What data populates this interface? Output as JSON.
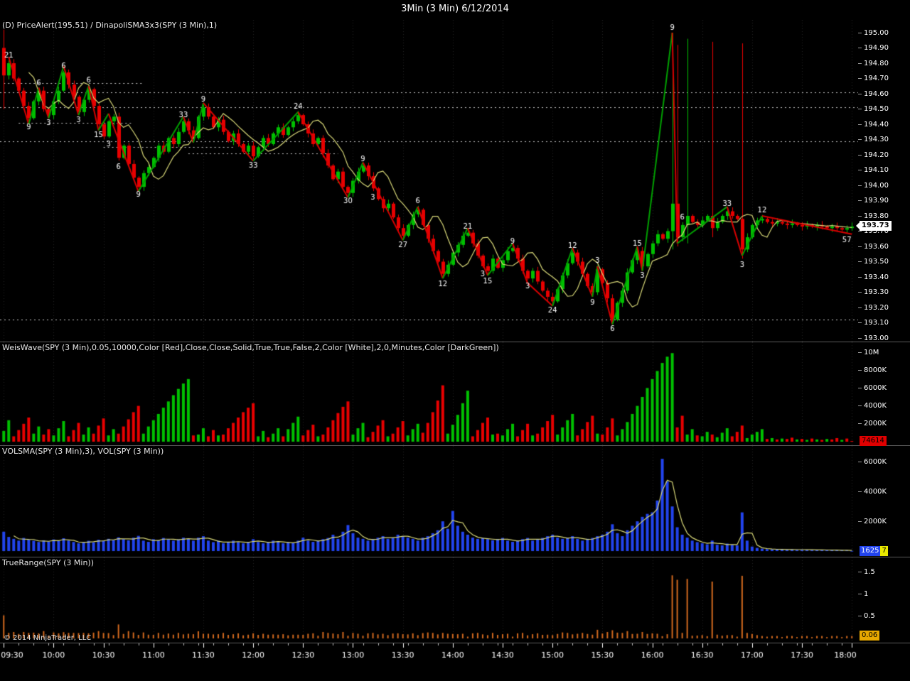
{
  "header": {
    "title": "3Min (3 Min)  6/12/2014"
  },
  "footer": {
    "copyright": "© 2014 NinjaTrader, LLC"
  },
  "colors": {
    "background": "#000000",
    "up": "#00C000",
    "down": "#E80000",
    "sma": "#D8D878",
    "vol": "#2244EE",
    "tr": "#D2691E",
    "grid": "#242424",
    "level": "#C8C8C8",
    "zig_up": "#00A000",
    "zig_down": "#D80000",
    "marker_price_bg": "#FFFFFF",
    "marker_wave_bg": "#E00000",
    "marker_vol_bg": "#2244EE",
    "marker_vol_highlight": "#E8E800",
    "marker_tr_bg": "#E8A800"
  },
  "chart_data": {
    "type": "candlestick",
    "symbol_interval": "SPY (3 Min)",
    "bars_per_label": 10,
    "time_labels": [
      "09:30",
      "10:00",
      "10:30",
      "11:00",
      "11:30",
      "12:00",
      "12:30",
      "13:00",
      "13:30",
      "14:00",
      "14:30",
      "15:00",
      "15:30",
      "16:00",
      "16:30",
      "17:00",
      "17:30",
      "18:00"
    ],
    "panels": [
      {
        "name": "price",
        "label": "(D) PriceAlert(195.51) / DinapoliSMA3x3(SPY (3 Min),1)",
        "ylim": [
          193.0,
          195.0
        ],
        "y_ticks": [
          "195.00",
          "194.90",
          "194.80",
          "194.70",
          "194.60",
          "194.50",
          "194.40",
          "194.30",
          "194.20",
          "194.10",
          "194.00",
          "193.90",
          "193.80",
          "193.70",
          "193.60",
          "193.50",
          "193.40",
          "193.30",
          "193.20",
          "193.10",
          "193.00"
        ],
        "last_value": "193.73",
        "open_first": 194.9,
        "closes": [
          194.72,
          194.8,
          194.7,
          194.62,
          194.52,
          194.44,
          194.55,
          194.62,
          194.5,
          194.46,
          194.55,
          194.62,
          194.74,
          194.66,
          194.58,
          194.48,
          194.56,
          194.63,
          194.52,
          194.4,
          194.32,
          194.42,
          194.45,
          194.18,
          194.26,
          194.14,
          194.05,
          193.99,
          194.08,
          194.12,
          194.18,
          194.26,
          194.22,
          194.31,
          194.27,
          194.35,
          194.42,
          194.36,
          194.31,
          194.45,
          194.51,
          194.45,
          194.38,
          194.43,
          194.35,
          194.29,
          194.34,
          194.27,
          194.22,
          194.26,
          194.19,
          194.25,
          194.31,
          194.27,
          194.34,
          194.38,
          194.33,
          194.38,
          194.42,
          194.46,
          194.4,
          194.34,
          194.27,
          194.31,
          194.21,
          194.13,
          194.04,
          194.09,
          193.99,
          193.95,
          194.03,
          194.09,
          194.13,
          194.06,
          193.98,
          193.91,
          193.85,
          193.88,
          193.79,
          193.72,
          193.67,
          193.74,
          193.81,
          193.84,
          193.74,
          193.65,
          193.57,
          193.5,
          193.42,
          193.48,
          193.56,
          193.61,
          193.67,
          193.69,
          193.62,
          193.54,
          193.47,
          193.44,
          193.52,
          193.46,
          193.51,
          193.57,
          193.59,
          193.52,
          193.44,
          193.39,
          193.44,
          193.37,
          193.31,
          193.27,
          193.24,
          193.32,
          193.41,
          193.49,
          193.56,
          193.5,
          193.42,
          193.34,
          193.3,
          193.45,
          193.36,
          193.26,
          193.12,
          193.23,
          193.31,
          193.43,
          193.51,
          193.57,
          193.47,
          193.55,
          193.62,
          193.68,
          193.65,
          193.7,
          193.88,
          193.66,
          193.74,
          193.8,
          193.76,
          193.74,
          193.77,
          193.8,
          193.72,
          193.76,
          193.8,
          193.83,
          193.8,
          193.78,
          193.58,
          193.66,
          193.74,
          193.77,
          193.78,
          193.76,
          193.75,
          193.76,
          193.75,
          193.74,
          193.75,
          193.74,
          193.73,
          193.74,
          193.73,
          193.74,
          193.73,
          193.72,
          193.73,
          193.72,
          193.71,
          193.72,
          193.73
        ],
        "spikes": {
          "0": {
            "h": 195.02,
            "l": 194.5
          },
          "134": {
            "h": 195.0,
            "l": 193.58
          },
          "135": {
            "h": 194.92,
            "l": 193.6
          },
          "137": {
            "h": 194.96,
            "l": 193.62
          },
          "142": {
            "h": 194.94,
            "l": 193.66
          },
          "148": {
            "h": 194.93,
            "l": 193.52
          }
        },
        "swing_labels": [
          [
            1,
            "21",
            "a"
          ],
          [
            5,
            "9",
            "b"
          ],
          [
            7,
            "6",
            "a"
          ],
          [
            9,
            "3",
            "b"
          ],
          [
            12,
            "6",
            "a"
          ],
          [
            15,
            "3",
            "b"
          ],
          [
            17,
            "6",
            "a"
          ],
          [
            19,
            "15",
            "b"
          ],
          [
            21,
            "3",
            "b"
          ],
          [
            23,
            "6",
            "b"
          ],
          [
            27,
            "9",
            "b"
          ],
          [
            36,
            "33",
            "a"
          ],
          [
            40,
            "9",
            "a"
          ],
          [
            50,
            "33",
            "b"
          ],
          [
            59,
            "24",
            "a"
          ],
          [
            69,
            "30",
            "b"
          ],
          [
            72,
            "9",
            "a"
          ],
          [
            74,
            "3",
            "b"
          ],
          [
            80,
            "27",
            "b"
          ],
          [
            83,
            "6",
            "a"
          ],
          [
            88,
            "12",
            "b"
          ],
          [
            93,
            "21",
            "a"
          ],
          [
            96,
            "3",
            "b"
          ],
          [
            97,
            "15",
            "b"
          ],
          [
            102,
            "9",
            "a"
          ],
          [
            105,
            "3",
            "b"
          ],
          [
            110,
            "24",
            "b"
          ],
          [
            114,
            "12",
            "a"
          ],
          [
            118,
            "9",
            "b"
          ],
          [
            119,
            "3",
            "a"
          ],
          [
            122,
            "6",
            "b"
          ],
          [
            127,
            "15",
            "a"
          ],
          [
            128,
            "3",
            "b"
          ],
          [
            134,
            "9",
            "a"
          ],
          [
            136,
            "6",
            "a"
          ],
          [
            145,
            "33",
            "a"
          ],
          [
            148,
            "3",
            "b"
          ],
          [
            152,
            "12",
            "a"
          ],
          [
            169,
            "57",
            "b"
          ]
        ],
        "zigzag": [
          [
            1,
            194.84
          ],
          [
            5,
            194.4
          ],
          [
            7,
            194.64
          ],
          [
            9,
            194.44
          ],
          [
            12,
            194.78
          ],
          [
            15,
            194.46
          ],
          [
            17,
            194.65
          ],
          [
            19,
            194.36
          ],
          [
            21,
            194.47
          ],
          [
            27,
            193.96
          ],
          [
            36,
            194.45
          ],
          [
            38,
            194.28
          ],
          [
            40,
            194.54
          ],
          [
            50,
            194.16
          ],
          [
            59,
            194.48
          ],
          [
            69,
            193.92
          ],
          [
            72,
            194.15
          ],
          [
            80,
            193.64
          ],
          [
            83,
            193.86
          ],
          [
            88,
            193.39
          ],
          [
            93,
            193.72
          ],
          [
            97,
            193.41
          ],
          [
            102,
            193.62
          ],
          [
            105,
            193.36
          ],
          [
            110,
            193.21
          ],
          [
            114,
            193.59
          ],
          [
            118,
            193.27
          ],
          [
            119,
            193.47
          ],
          [
            122,
            193.09
          ],
          [
            127,
            193.6
          ],
          [
            128,
            193.44
          ],
          [
            134,
            195.0
          ],
          [
            135,
            193.62
          ],
          [
            145,
            193.86
          ],
          [
            148,
            193.54
          ],
          [
            152,
            193.8
          ],
          [
            170,
            193.68
          ]
        ],
        "alert_levels": [
          194.61,
          194.51,
          194.29,
          193.12
        ],
        "alert_segments": [
          {
            "p": 194.67,
            "a": 0,
            "b": 28
          },
          {
            "p": 194.41,
            "a": 3,
            "b": 26
          },
          {
            "p": 194.25,
            "a": 20,
            "b": 46
          },
          {
            "p": 194.21,
            "a": 37,
            "b": 67
          }
        ]
      },
      {
        "name": "weiswave",
        "label": "WeisWave(SPY (3 Min),0.05,10000,Color [Red],Close,Close,Solid,True,True,False,2,Color [White],2,0,Minutes,Color [DarkGreen])",
        "ylim": [
          0,
          10000
        ],
        "y_ticks": [
          {
            "label": "2000K",
            "value": 2000
          },
          {
            "label": "4000K",
            "value": 4000
          },
          {
            "label": "6000K",
            "value": 6000
          },
          {
            "label": "8000K",
            "value": 8000
          },
          {
            "label": "10M",
            "value": 10000
          }
        ],
        "last_value": "74614",
        "values": [
          1200,
          2400,
          -600,
          -1300,
          -2000,
          -2700,
          900,
          1700,
          -800,
          -1400,
          700,
          1500,
          2300,
          -600,
          -1300,
          -2100,
          800,
          1600,
          -900,
          -1800,
          -2600,
          700,
          1400,
          -900,
          -1700,
          -2500,
          -3300,
          -4000,
          900,
          1700,
          2400,
          3100,
          3800,
          4500,
          5200,
          5900,
          6500,
          7000,
          -700,
          800,
          1500,
          -600,
          -1300,
          700,
          -800,
          -1500,
          -2100,
          -2700,
          -3300,
          -3800,
          -4300,
          600,
          1200,
          -500,
          900,
          1500,
          -600,
          1400,
          2100,
          2800,
          -700,
          -1300,
          -1900,
          600,
          -800,
          -1600,
          -2400,
          -3200,
          -3900,
          -4500,
          800,
          1500,
          2100,
          -500,
          -1100,
          -1800,
          -2400,
          600,
          -900,
          -1600,
          -2300,
          700,
          1400,
          2000,
          -1000,
          -2100,
          -3300,
          -4600,
          -6300,
          900,
          1900,
          3000,
          4300,
          5700,
          -600,
          -1300,
          -2100,
          -2700,
          800,
          -900,
          700,
          1400,
          2000,
          -600,
          -1300,
          -2000,
          700,
          -900,
          -1600,
          -2300,
          -3000,
          800,
          1600,
          2400,
          3100,
          -700,
          -1400,
          -2200,
          -2900,
          900,
          -800,
          -1600,
          -2600,
          700,
          1400,
          2200,
          3100,
          4000,
          5000,
          6000,
          7000,
          7900,
          8800,
          9500,
          9900,
          -1600,
          -2900,
          800,
          1400,
          -700,
          600,
          1100,
          -800,
          500,
          1000,
          1500,
          -600,
          -1100,
          -1800,
          400,
          800,
          1100,
          1400,
          -300,
          400,
          -250,
          350,
          -300,
          -450,
          250,
          -300,
          200,
          -350,
          250,
          -200,
          300,
          -250,
          -400,
          200,
          -350,
          -75
        ]
      },
      {
        "name": "volume",
        "label": "VOLSMA(SPY (3 Min),3), VOL(SPY (3 Min))",
        "ylim": [
          0,
          6400
        ],
        "y_ticks": [
          {
            "label": "2000K",
            "value": 2000
          },
          {
            "label": "4000K",
            "value": 4000
          },
          {
            "label": "6000K",
            "value": 6000
          }
        ],
        "last_value": "16257",
        "last_value_parts": [
          "1625",
          "7"
        ],
        "sma_period": 3,
        "values": [
          1300,
          950,
          820,
          700,
          880,
          760,
          690,
          610,
          720,
          640,
          780,
          690,
          860,
          700,
          610,
          520,
          600,
          690,
          580,
          760,
          700,
          820,
          740,
          920,
          800,
          720,
          900,
          1020,
          700,
          620,
          800,
          720,
          880,
          800,
          700,
          780,
          900,
          820,
          700,
          900,
          1000,
          700,
          600,
          700,
          520,
          600,
          700,
          600,
          520,
          610,
          800,
          610,
          520,
          600,
          700,
          620,
          520,
          600,
          540,
          700,
          900,
          700,
          620,
          700,
          800,
          880,
          1100,
          820,
          1300,
          1750,
          1200,
          900,
          820,
          700,
          800,
          900,
          1000,
          820,
          880,
          1100,
          1000,
          900,
          820,
          700,
          900,
          1000,
          1200,
          1400,
          2000,
          1500,
          2700,
          1700,
          1300,
          1100,
          900,
          820,
          880,
          800,
          720,
          800,
          880,
          700,
          620,
          700,
          800,
          880,
          700,
          800,
          880,
          1000,
          1100,
          900,
          820,
          880,
          1000,
          820,
          700,
          820,
          880,
          1000,
          1100,
          1300,
          1800,
          1200,
          1000,
          1400,
          1700,
          2000,
          2300,
          2500,
          2600,
          3400,
          6200,
          4700,
          3000,
          1600,
          1100,
          900,
          700,
          600,
          520,
          450,
          700,
          420,
          380,
          500,
          420,
          380,
          2600,
          700,
          300,
          210,
          160,
          130,
          110,
          120,
          100,
          95,
          105,
          85,
          95,
          85,
          75,
          80,
          65,
          70,
          60,
          55,
          60,
          50,
          16
        ]
      },
      {
        "name": "truerange",
        "label": "TrueRange(SPY (3 Min))",
        "ylim": [
          0,
          1.6
        ],
        "y_ticks": [
          {
            "label": "0.5",
            "value": 0.5
          },
          {
            "label": "1",
            "value": 1
          },
          {
            "label": "1.5",
            "value": 1.5
          }
        ],
        "last_value": "0.06"
      }
    ]
  }
}
